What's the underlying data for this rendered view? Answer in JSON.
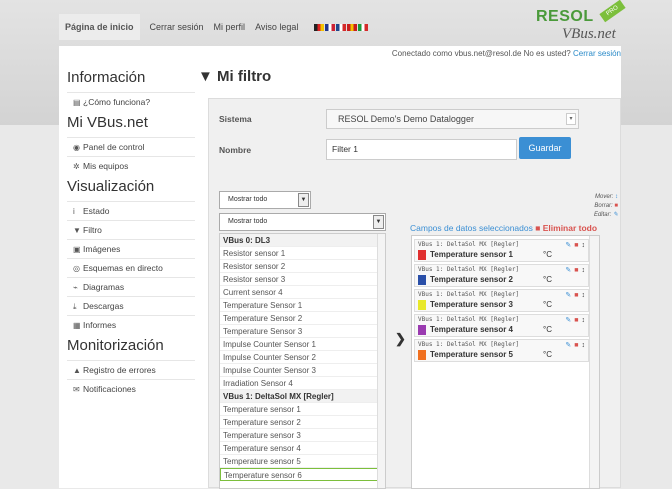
{
  "top_nav": {
    "items": [
      "Página de inicio",
      "Cerrar sesión",
      "Mi perfil",
      "Aviso legal"
    ],
    "active_index": 0,
    "flags": [
      {
        "name": "german-flag-icon",
        "colors": [
          "#222222",
          "#dd2222",
          "#f2c200"
        ]
      },
      {
        "name": "uk-flag-icon",
        "colors": [
          "#21368c",
          "#ffffff",
          "#cc2233"
        ]
      },
      {
        "name": "french-flag-icon",
        "colors": [
          "#21468b",
          "#ffffff",
          "#d42a2a"
        ]
      },
      {
        "name": "spanish-flag-icon",
        "colors": [
          "#c81e1e",
          "#f2c200",
          "#c81e1e"
        ]
      },
      {
        "name": "italian-flag-icon",
        "colors": [
          "#1a9a3a",
          "#ffffff",
          "#d42a2a"
        ]
      }
    ]
  },
  "logo": {
    "brand": "RESOL",
    "product": "VBus.net",
    "badge": "PRO"
  },
  "header": {
    "connected_as": "Conectado como vbus.net@resol.de No es usted?",
    "logout_link": "Cerrar sesión"
  },
  "sidebar": {
    "sections": [
      {
        "title": "Información",
        "items": [
          {
            "icon": "book-icon",
            "glyph": "▤",
            "label": "¿Cómo funciona?"
          }
        ]
      },
      {
        "title": "Mi VBus.net",
        "items": [
          {
            "icon": "dashboard-icon",
            "glyph": "◉",
            "label": "Panel de control"
          },
          {
            "icon": "cog-icon",
            "glyph": "✲",
            "label": "Mis equipos"
          }
        ]
      },
      {
        "title": "Visualización",
        "items": [
          {
            "icon": "info-icon",
            "glyph": "i",
            "label": "Estado"
          },
          {
            "icon": "filter-icon",
            "glyph": "▼",
            "label": "Filtro"
          },
          {
            "icon": "image-icon",
            "glyph": "▣",
            "label": "Imágenes"
          },
          {
            "icon": "eye-icon",
            "glyph": "◎",
            "label": "Esquemas en directo"
          },
          {
            "icon": "chart-icon",
            "glyph": "⌁",
            "label": "Diagramas"
          },
          {
            "icon": "download-icon",
            "glyph": "⤓",
            "label": "Descargas"
          },
          {
            "icon": "report-icon",
            "glyph": "▦",
            "label": "Informes"
          }
        ]
      },
      {
        "title": "Monitorización",
        "items": [
          {
            "icon": "warning-icon",
            "glyph": "▲",
            "label": "Registro de errores"
          },
          {
            "icon": "notification-icon",
            "glyph": "✉",
            "label": "Notificaciones"
          }
        ]
      }
    ]
  },
  "page": {
    "title": "Mi filtro",
    "title_icon": "filter-icon"
  },
  "form": {
    "sistema_label": "Sistema",
    "sistema_value": "RESOL Demo's Demo Datalogger",
    "nombre_label": "Nombre",
    "nombre_value": "Filter 1",
    "save_label": "Guardar"
  },
  "filters": {
    "show_all_1": "Mostrar todo",
    "show_all_2": "Mostrar todo"
  },
  "source_list": [
    {
      "label": "VBus 0: DL3",
      "group": true
    },
    {
      "label": "Resistor sensor 1"
    },
    {
      "label": "Resistor sensor 2"
    },
    {
      "label": "Resistor sensor 3"
    },
    {
      "label": "Current sensor 4"
    },
    {
      "label": "Temperature Sensor 1"
    },
    {
      "label": "Temperature Sensor 2"
    },
    {
      "label": "Temperature Sensor 3"
    },
    {
      "label": "Impulse Counter Sensor 1"
    },
    {
      "label": "Impulse Counter Sensor 2"
    },
    {
      "label": "Impulse Counter Sensor 3"
    },
    {
      "label": "Irradiation Sensor 4"
    },
    {
      "label": "VBus 1: DeltaSol MX [Regler]",
      "group": true
    },
    {
      "label": "Temperature sensor 1"
    },
    {
      "label": "Temperature sensor 2"
    },
    {
      "label": "Temperature sensor 3"
    },
    {
      "label": "Temperature sensor 4"
    },
    {
      "label": "Temperature sensor 5"
    },
    {
      "label": "Temperature sensor 6",
      "highlight": true
    }
  ],
  "legend": {
    "move": "Mover:",
    "delete": "Borrar:",
    "edit": "Editar:"
  },
  "selected": {
    "heading": "Campos de datos seleccionados",
    "delete_all": "Eliminar todo",
    "items": [
      {
        "source": "VBus 1: DeltaSol MX [Regler]",
        "name": "Temperature sensor 1",
        "unit": "°C",
        "color": "#e03030"
      },
      {
        "source": "VBus 1: DeltaSol MX [Regler]",
        "name": "Temperature sensor 2",
        "unit": "°C",
        "color": "#2a4fa8"
      },
      {
        "source": "VBus 1: DeltaSol MX [Regler]",
        "name": "Temperature sensor 3",
        "unit": "°C",
        "color": "#e8e82a"
      },
      {
        "source": "VBus 1: DeltaSol MX [Regler]",
        "name": "Temperature sensor 4",
        "unit": "°C",
        "color": "#9a3ab0"
      },
      {
        "source": "VBus 1: DeltaSol MX [Regler]",
        "name": "Temperature sensor 5",
        "unit": "°C",
        "color": "#f07020"
      }
    ]
  }
}
